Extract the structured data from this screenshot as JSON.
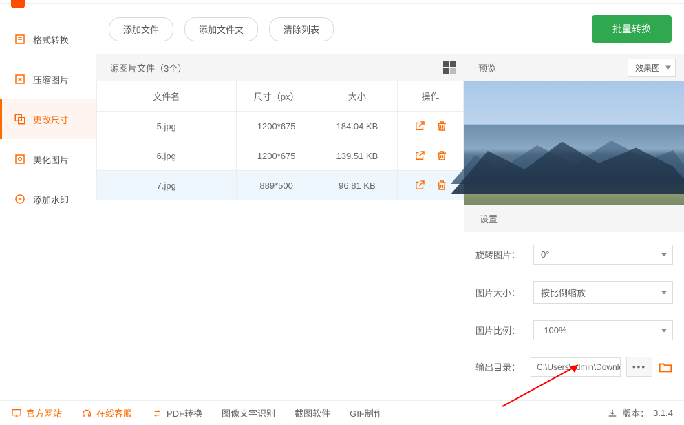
{
  "sidebar": {
    "items": [
      {
        "label": "格式转换"
      },
      {
        "label": "压缩图片"
      },
      {
        "label": "更改尺寸"
      },
      {
        "label": "美化图片"
      },
      {
        "label": "添加水印"
      }
    ]
  },
  "toolbar": {
    "add_file": "添加文件",
    "add_folder": "添加文件夹",
    "clear_list": "清除列表",
    "batch_convert": "批量转换"
  },
  "filelist": {
    "header": "源图片文件（3个）",
    "columns": {
      "name": "文件名",
      "dim": "尺寸（px）",
      "size": "大小",
      "op": "操作"
    },
    "rows": [
      {
        "name": "5.jpg",
        "dim": "1200*675",
        "size": "184.04 KB"
      },
      {
        "name": "6.jpg",
        "dim": "1200*675",
        "size": "139.51 KB"
      },
      {
        "name": "7.jpg",
        "dim": "889*500",
        "size": "96.81 KB"
      }
    ]
  },
  "preview": {
    "title": "预览",
    "effect_label": "效果图"
  },
  "settings": {
    "title": "设置",
    "rotate_label": "旋转图片：",
    "rotate_value": "0°",
    "size_label": "图片大小：",
    "size_value": "按比例缩放",
    "ratio_label": "图片比例：",
    "ratio_value": "-100%",
    "output_label": "输出目录：",
    "output_path": "C:\\Users\\admin\\Downloads"
  },
  "footer": {
    "website": "官方网站",
    "support": "在线客服",
    "pdf": "PDF转换",
    "ocr": "图像文字识别",
    "screenshot": "截图软件",
    "gif": "GIF制作",
    "version_label": "版本：",
    "version": "3.1.4"
  }
}
